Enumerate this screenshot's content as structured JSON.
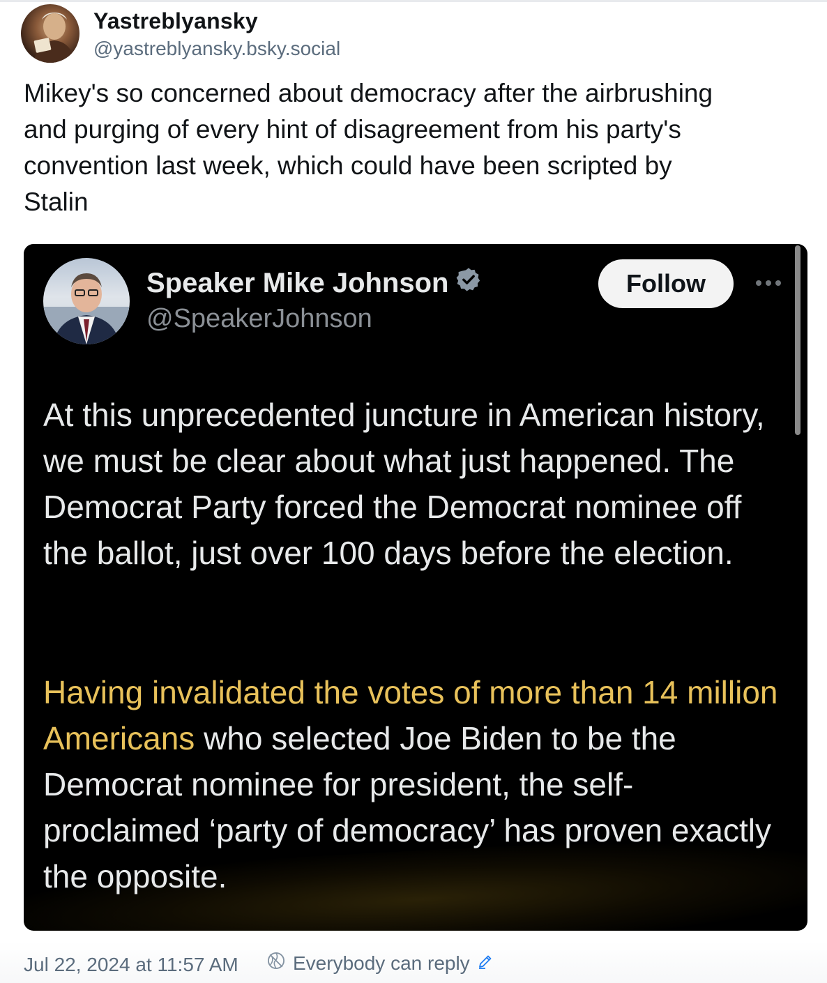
{
  "author": {
    "display_name": "Yastreblyansky",
    "handle": "@yastreblyansky.bsky.social"
  },
  "post": {
    "text": "Mikey's so concerned about democracy after the airbrushing\nand purging of every hint of disagreement from his party's\nconvention last week, which could have been scripted by\nStalin"
  },
  "embed": {
    "display_name": "Speaker Mike Johnson",
    "handle": "@SpeakerJohnson",
    "follow_label": "Follow",
    "verified_icon": "verified-badge-icon",
    "paragraph1": "At this unprecedented juncture in American history, we must be clear about what just happened. The Democrat Party forced the Democrat nominee off the ballot, just over 100 days before the election.",
    "paragraph2_highlight": "Having invalidated the votes of more than 14 million Americans",
    "paragraph2_rest": " who selected Joe Biden to be the Democrat nominee for president, the self-proclaimed ‘party of democracy’ has proven exactly the opposite.",
    "highlight_color": "#e8c15a"
  },
  "footer": {
    "timestamp": "Jul 22, 2024 at 11:57 AM",
    "reply_setting": "Everybody can reply",
    "reply_icon": "globe-crossed-icon",
    "edit_icon": "pencil-icon"
  }
}
